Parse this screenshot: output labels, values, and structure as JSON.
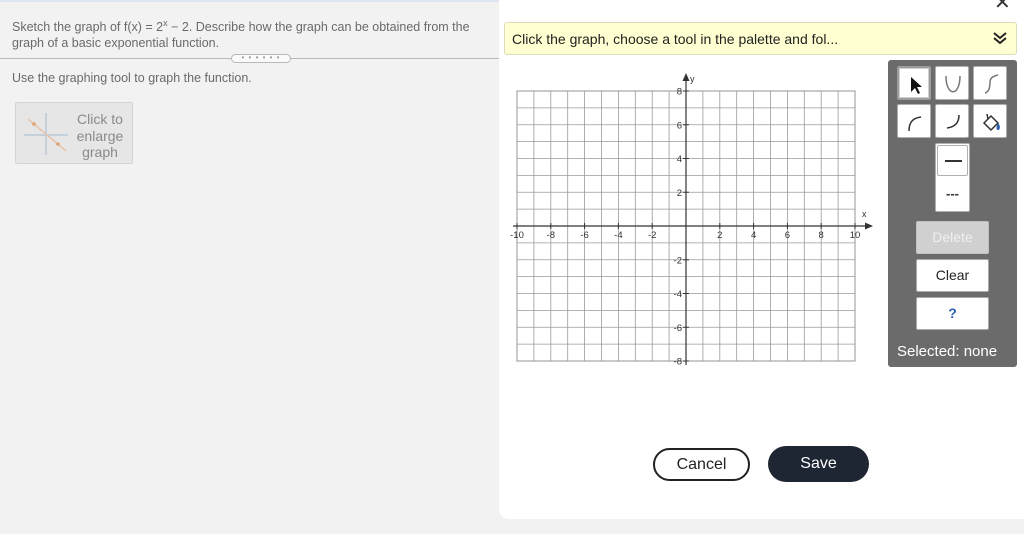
{
  "question": {
    "prefix": "Sketch the graph of f(x) = 2",
    "exponent": "x",
    "suffix": " − 2. Describe how the graph can be obtained from the graph of a basic exponential function."
  },
  "splitter_dots": "• • • • • •",
  "instruction": "Use the graphing tool to graph the function.",
  "enlarge": {
    "label": "Click to enlarge graph"
  },
  "hint": {
    "text": "Click the graph, choose a tool in the palette and fol..."
  },
  "graph": {
    "x_axis_label": "x",
    "y_axis_label": "y",
    "x_ticks": [
      "-10",
      "-8",
      "-6",
      "-4",
      "-2",
      "2",
      "4",
      "6",
      "8",
      "10"
    ],
    "y_ticks": [
      "8",
      "6",
      "4",
      "2",
      "-2",
      "-4",
      "-6",
      "-8"
    ],
    "x_range": [
      -10,
      10
    ],
    "y_range": [
      -8,
      8
    ],
    "grid_step": 1
  },
  "palette": {
    "tools": [
      "pointer-icon",
      "parabola-up-icon",
      "exponential-curve-icon",
      "curve-left-icon",
      "curve-right-icon",
      "fill-bucket-icon",
      "solid-line-icon",
      "dashed-line-icon"
    ],
    "dashed_symbol": "---",
    "delete_label": "Delete",
    "clear_label": "Clear",
    "help_label": "?",
    "selected_text": "Selected: none"
  },
  "footer": {
    "cancel_label": "Cancel",
    "save_label": "Save"
  },
  "colors": {
    "hint_bg": "#ffffd2",
    "palette_bg": "#6b6b6b",
    "save_bg": "#1e2633",
    "help": "#2a5fb0"
  }
}
